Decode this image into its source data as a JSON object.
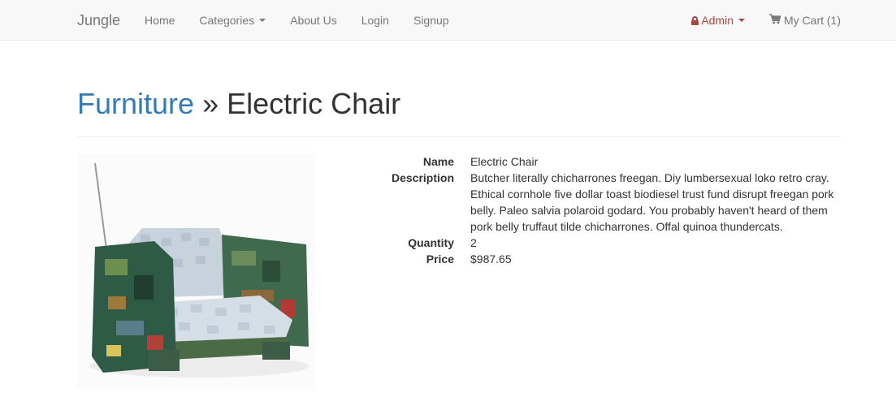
{
  "navbar": {
    "brand": "Jungle",
    "links": {
      "home": "Home",
      "categories": "Categories",
      "about": "About Us",
      "login": "Login",
      "signup": "Signup"
    },
    "admin": "Admin",
    "cart": "My Cart (1)"
  },
  "header": {
    "category": "Furniture",
    "separator": "»",
    "product": "Electric Chair"
  },
  "product": {
    "image_alt": "Electric Chair",
    "labels": {
      "name": "Name",
      "description": "Description",
      "quantity": "Quantity",
      "price": "Price"
    },
    "name": "Electric Chair",
    "description": "Butcher literally chicharrones freegan. Diy lumbersexual loko retro cray. Ethical cornhole five dollar toast biodiesel trust fund disrupt freegan pork belly. Paleo salvia polaroid godard. You probably haven't heard of them pork belly truffaut tilde chicharrones. Offal quinoa thundercats.",
    "quantity": "2",
    "price": "$987.65"
  },
  "colors": {
    "link": "#337ab7",
    "admin": "#a94442",
    "navbar_bg": "#f8f8f8",
    "nav_text": "#777777"
  },
  "icons": {
    "admin": "lock-icon",
    "cart": "shopping-cart-icon",
    "dropdown": "caret-down-icon"
  }
}
